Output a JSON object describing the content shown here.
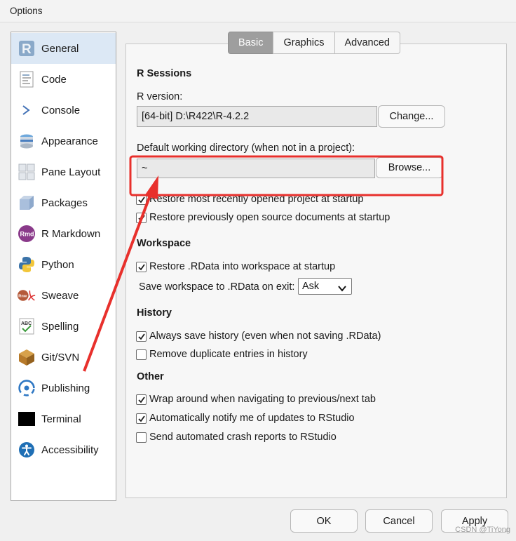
{
  "window": {
    "title": "Options"
  },
  "sidebar": {
    "items": [
      {
        "label": "General",
        "icon": "r-logo-icon",
        "selected": true
      },
      {
        "label": "Code",
        "icon": "code-document-icon"
      },
      {
        "label": "Console",
        "icon": "console-prompt-icon"
      },
      {
        "label": "Appearance",
        "icon": "appearance-icon"
      },
      {
        "label": "Pane Layout",
        "icon": "pane-layout-icon"
      },
      {
        "label": "Packages",
        "icon": "package-box-icon"
      },
      {
        "label": "R Markdown",
        "icon": "rmd-icon"
      },
      {
        "label": "Python",
        "icon": "python-logo-icon"
      },
      {
        "label": "Sweave",
        "icon": "sweave-pdf-icon"
      },
      {
        "label": "Spelling",
        "icon": "spellcheck-icon"
      },
      {
        "label": "Git/SVN",
        "icon": "git-box-icon"
      },
      {
        "label": "Publishing",
        "icon": "publishing-icon"
      },
      {
        "label": "Terminal",
        "icon": "terminal-icon"
      },
      {
        "label": "Accessibility",
        "icon": "accessibility-icon"
      }
    ]
  },
  "tabs": [
    {
      "label": "Basic",
      "active": true
    },
    {
      "label": "Graphics"
    },
    {
      "label": "Advanced"
    }
  ],
  "r_sessions": {
    "heading": "R Sessions",
    "r_version_label": "R version:",
    "r_version_value": "[64-bit] D:\\R422\\R-4.2.2",
    "change_button": "Change...",
    "wd_label": "Default working directory (when not in a project):",
    "wd_value": "~",
    "browse_button": "Browse...",
    "restore_project": {
      "label": "Restore most recently opened project at startup",
      "checked": true
    },
    "restore_docs": {
      "label": "Restore previously open source documents at startup",
      "checked": true
    }
  },
  "workspace": {
    "heading": "Workspace",
    "restore_rdata": {
      "label": "Restore .RData into workspace at startup",
      "checked": true
    },
    "save_label": "Save workspace to .RData on exit:",
    "save_value": "Ask"
  },
  "history": {
    "heading": "History",
    "always_save": {
      "label": "Always save history (even when not saving .RData)",
      "checked": true
    },
    "remove_dupes": {
      "label": "Remove duplicate entries in history",
      "checked": false
    }
  },
  "other": {
    "heading": "Other",
    "wrap_around": {
      "label": "Wrap around when navigating to previous/next tab",
      "checked": true
    },
    "auto_notify": {
      "label": "Automatically notify me of updates to RStudio",
      "checked": true
    },
    "crash_reports": {
      "label": "Send automated crash reports to RStudio",
      "checked": false
    }
  },
  "footer": {
    "ok": "OK",
    "cancel": "Cancel",
    "apply": "Apply"
  },
  "watermark": "CSDN @TiYong",
  "colors": {
    "highlight_red": "#e8302c",
    "tab_active": "#9e9e9e",
    "sidebar_selected": "#dce8f5"
  }
}
